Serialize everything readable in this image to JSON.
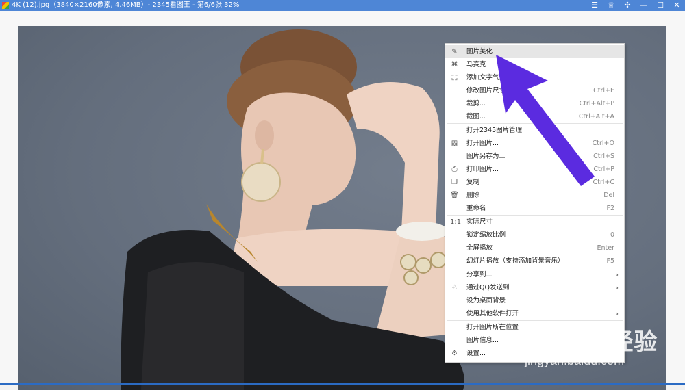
{
  "window": {
    "title": "4K (12).jpg（3840×2160像素, 4.46MB）- 2345看图王 - 第6/6张 32%",
    "buttons": [
      {
        "name": "menu-icon",
        "glyph": "☰"
      },
      {
        "name": "skin-icon",
        "glyph": "♕"
      },
      {
        "name": "compact-mode-icon",
        "glyph": "✣"
      },
      {
        "name": "minimize-icon",
        "glyph": "—"
      },
      {
        "name": "maximize-icon",
        "glyph": "☐"
      },
      {
        "name": "close-icon",
        "glyph": "✕"
      }
    ]
  },
  "context_menu": {
    "items": [
      {
        "label": "图片美化",
        "shortcut": "",
        "icon": "edit-icon",
        "glyph": "✎",
        "highlighted": true
      },
      {
        "label": "马赛克",
        "shortcut": "",
        "icon": "mosaic-icon",
        "glyph": "⌘"
      },
      {
        "label": "添加文字气泡",
        "shortcut": "",
        "icon": "text-bubble-icon",
        "glyph": "⬚"
      },
      {
        "label": "修改图片尺寸",
        "shortcut": "Ctrl+E"
      },
      {
        "label": "裁剪...",
        "shortcut": "Ctrl+Alt+P"
      },
      {
        "label": "截图...",
        "shortcut": "Ctrl+Alt+A"
      },
      {
        "separator": true
      },
      {
        "label": "打开2345图片管理",
        "shortcut": ""
      },
      {
        "label": "打开图片...",
        "shortcut": "Ctrl+O",
        "icon": "image-icon",
        "glyph": "▨"
      },
      {
        "label": "图片另存为...",
        "shortcut": "Ctrl+S"
      },
      {
        "label": "打印图片...",
        "shortcut": "Ctrl+P",
        "icon": "print-icon",
        "glyph": "⎙"
      },
      {
        "label": "复制",
        "shortcut": "Ctrl+C",
        "icon": "copy-icon",
        "glyph": "❐"
      },
      {
        "label": "删除",
        "shortcut": "Del",
        "icon": "trash-icon",
        "glyph": "🗑"
      },
      {
        "label": "重命名",
        "shortcut": "F2"
      },
      {
        "separator": true
      },
      {
        "label": "实际尺寸",
        "shortcut": "",
        "icon": "actual-size-icon",
        "glyph": "1:1"
      },
      {
        "label": "锁定缩放比例",
        "shortcut": "0"
      },
      {
        "label": "全屏播放",
        "shortcut": "Enter"
      },
      {
        "label": "幻灯片播放（支持添加背景音乐）",
        "shortcut": "F5"
      },
      {
        "separator": true
      },
      {
        "label": "分享到...",
        "shortcut": "",
        "submenu": true
      },
      {
        "label": "通过QQ发送到",
        "shortcut": "",
        "icon": "qq-icon",
        "glyph": "♘",
        "submenu": true
      },
      {
        "label": "设为桌面背景",
        "shortcut": ""
      },
      {
        "label": "使用其他软件打开",
        "shortcut": "",
        "submenu": true
      },
      {
        "separator": true
      },
      {
        "label": "打开图片所在位置",
        "shortcut": ""
      },
      {
        "label": "图片信息...",
        "shortcut": ""
      },
      {
        "label": "设置...",
        "shortcut": "",
        "icon": "gear-icon",
        "glyph": "⚙"
      }
    ]
  },
  "watermark": {
    "logo": "Bai du 经验",
    "url": "jingyan.baidu.com"
  },
  "colors": {
    "titlebar": "#4e86d6",
    "annotation_arrow": "#5b2be0",
    "menu_highlight": "#e6e6e6"
  }
}
